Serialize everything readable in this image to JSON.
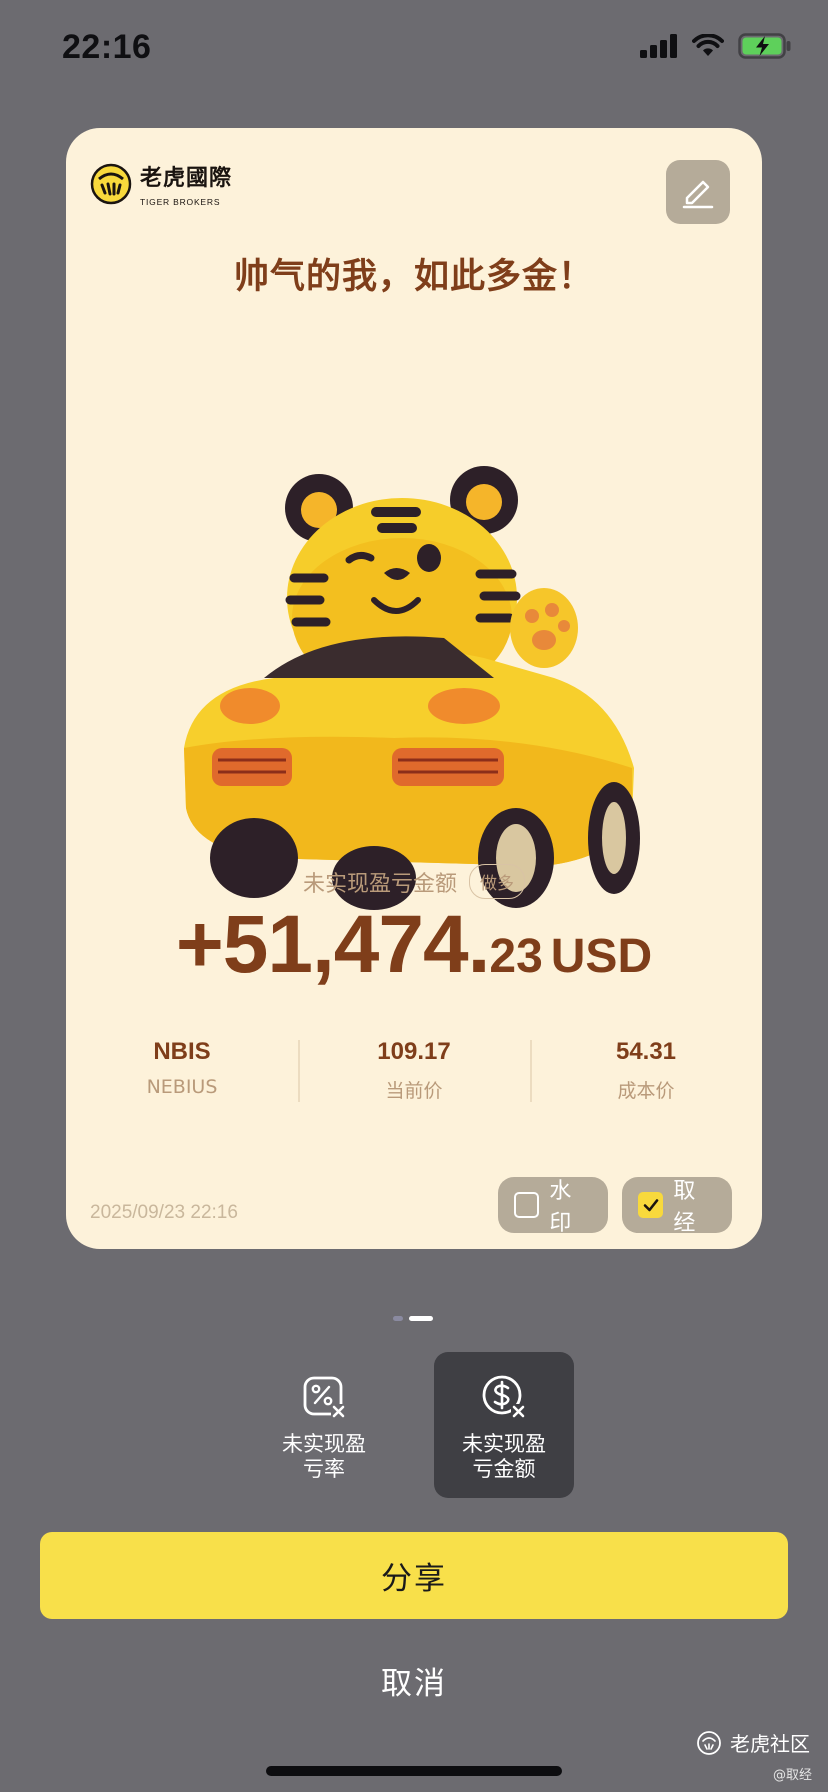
{
  "status_bar": {
    "time": "22:16",
    "icons": [
      "cellular-signal-icon",
      "wifi-icon",
      "battery-charging-icon"
    ]
  },
  "card": {
    "brand": {
      "name_cn": "老虎國際",
      "name_en": "TIGER BROKERS"
    },
    "edit_icon": "edit-pen-icon",
    "slogan": "帅气的我，如此多金！",
    "illustration": "tiger-mascot-in-yellow-car",
    "pl_label": "未实现盈亏金额",
    "position_badge": "做多",
    "amount": {
      "main": "+51,474.",
      "decimal": "23",
      "currency": "USD"
    },
    "stats": [
      {
        "value": "NBIS",
        "label": "NEBIUS"
      },
      {
        "value": "109.17",
        "label": "当前价"
      },
      {
        "value": "54.31",
        "label": "成本价"
      }
    ],
    "date": "2025/09/23 22:16",
    "toggles": {
      "watermark": {
        "label": "水印",
        "checked": false
      },
      "hide": {
        "label": "取经",
        "checked": true
      }
    }
  },
  "pager": {
    "pages": 2,
    "active_index": 1
  },
  "templates": [
    {
      "label_line1": "未实现盈",
      "label_line2": "亏率",
      "icon": "percent-tag-icon",
      "selected": false
    },
    {
      "label_line1": "未实现盈",
      "label_line2": "亏金额",
      "icon": "dollar-tag-icon",
      "selected": true
    }
  ],
  "actions": {
    "share": "分享",
    "cancel": "取消"
  },
  "watermark": {
    "community": "老虎社区",
    "handle": "@取经"
  },
  "colors": {
    "backdrop": "#6c6b70",
    "card_bg": "#fdf2da",
    "brown_text": "#7f3e1a",
    "muted_text": "#b99a7a",
    "share_yellow": "#f8e04a",
    "checkbox_yellow": "#f8d93c"
  }
}
